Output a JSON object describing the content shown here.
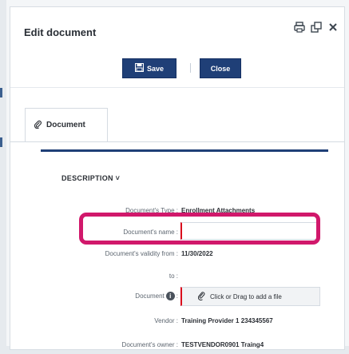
{
  "dialog": {
    "title": "Edit document",
    "controls": {
      "print_icon": "print-icon",
      "popout_icon": "popout-icon",
      "close_icon": "close-icon"
    }
  },
  "toolbar": {
    "save_label": "Save",
    "close_label": "Close"
  },
  "tabs": [
    {
      "label": "Document",
      "icon": "paperclip-icon"
    }
  ],
  "section": {
    "title": "DESCRIPTION"
  },
  "form": {
    "type_label": "Document's Type :",
    "type_value": "Enrollment Attachments",
    "name_label": "Document's name :",
    "name_value": "",
    "validity_from_label": "Document's validity from :",
    "validity_from_value": "11/30/2022",
    "validity_to_label": "to :",
    "document_label": "Document",
    "document_label_suffix": ":",
    "file_drop_text": "Click or Drag to add a file",
    "vendor_label": "Vendor :",
    "vendor_value": "Training Provider 1 234345567",
    "owner_label": "Document's owner :",
    "owner_value": "TESTVENDOR0901 Traing4"
  },
  "colors": {
    "primary": "#1f3f77",
    "required": "#d9001b",
    "highlight": "#d1186b"
  }
}
